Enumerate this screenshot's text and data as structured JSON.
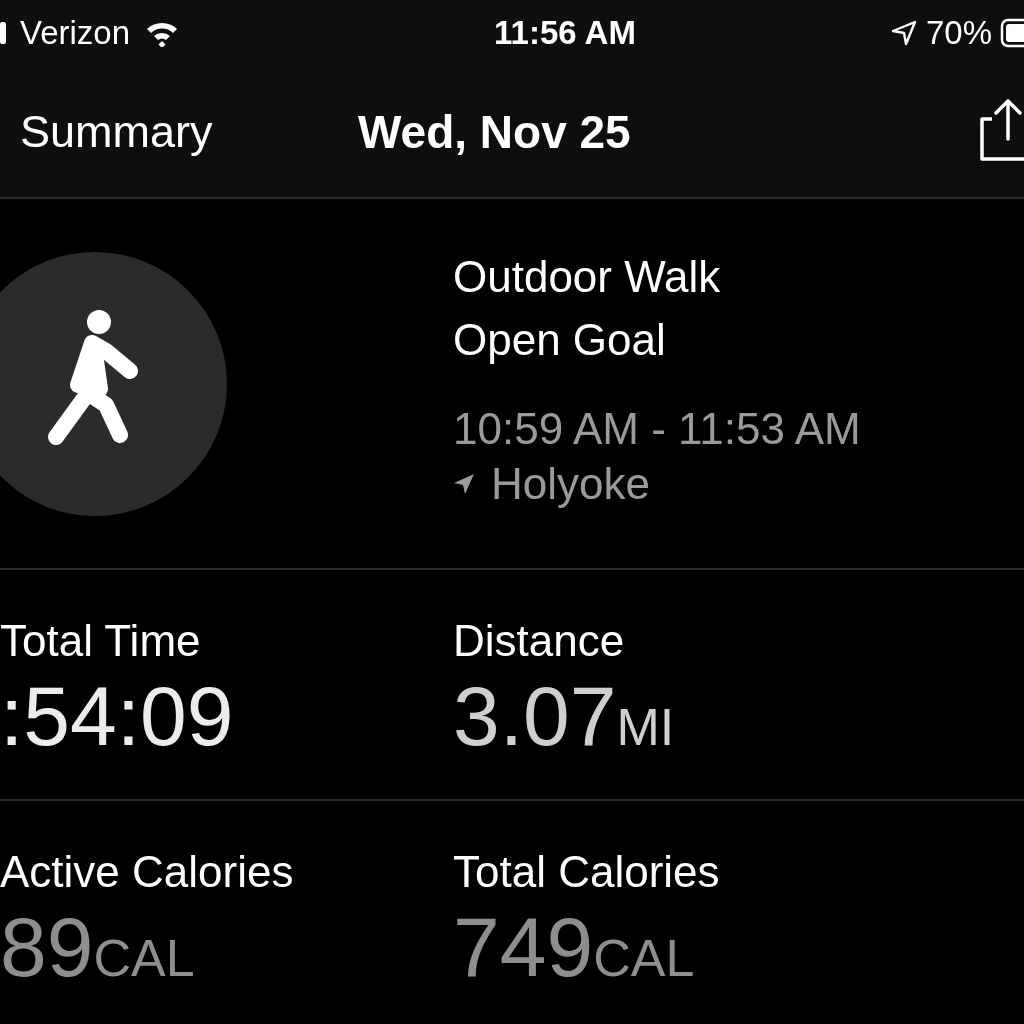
{
  "status_bar": {
    "carrier": "Verizon",
    "time": "11:56 AM",
    "battery": "70%"
  },
  "nav": {
    "back": "Summary",
    "title": "Wed, Nov 25"
  },
  "workout": {
    "name": "Outdoor Walk",
    "goal": "Open Goal",
    "time_range": "10:59 AM - 11:53 AM",
    "location": "Holyoke"
  },
  "stats": [
    {
      "label": "Total Time",
      "value": ":54:09",
      "color": "#ececec"
    },
    {
      "label": "Distance",
      "value": "3.07",
      "unit": "MI",
      "color": "#cfcfcf"
    },
    {
      "label": "Active Calories",
      "value": "89",
      "unit": "CAL",
      "color": "#8e8e8e"
    },
    {
      "label": "Total Calories",
      "value": "749",
      "unit": "CAL",
      "color": "#8e8e8e"
    }
  ]
}
